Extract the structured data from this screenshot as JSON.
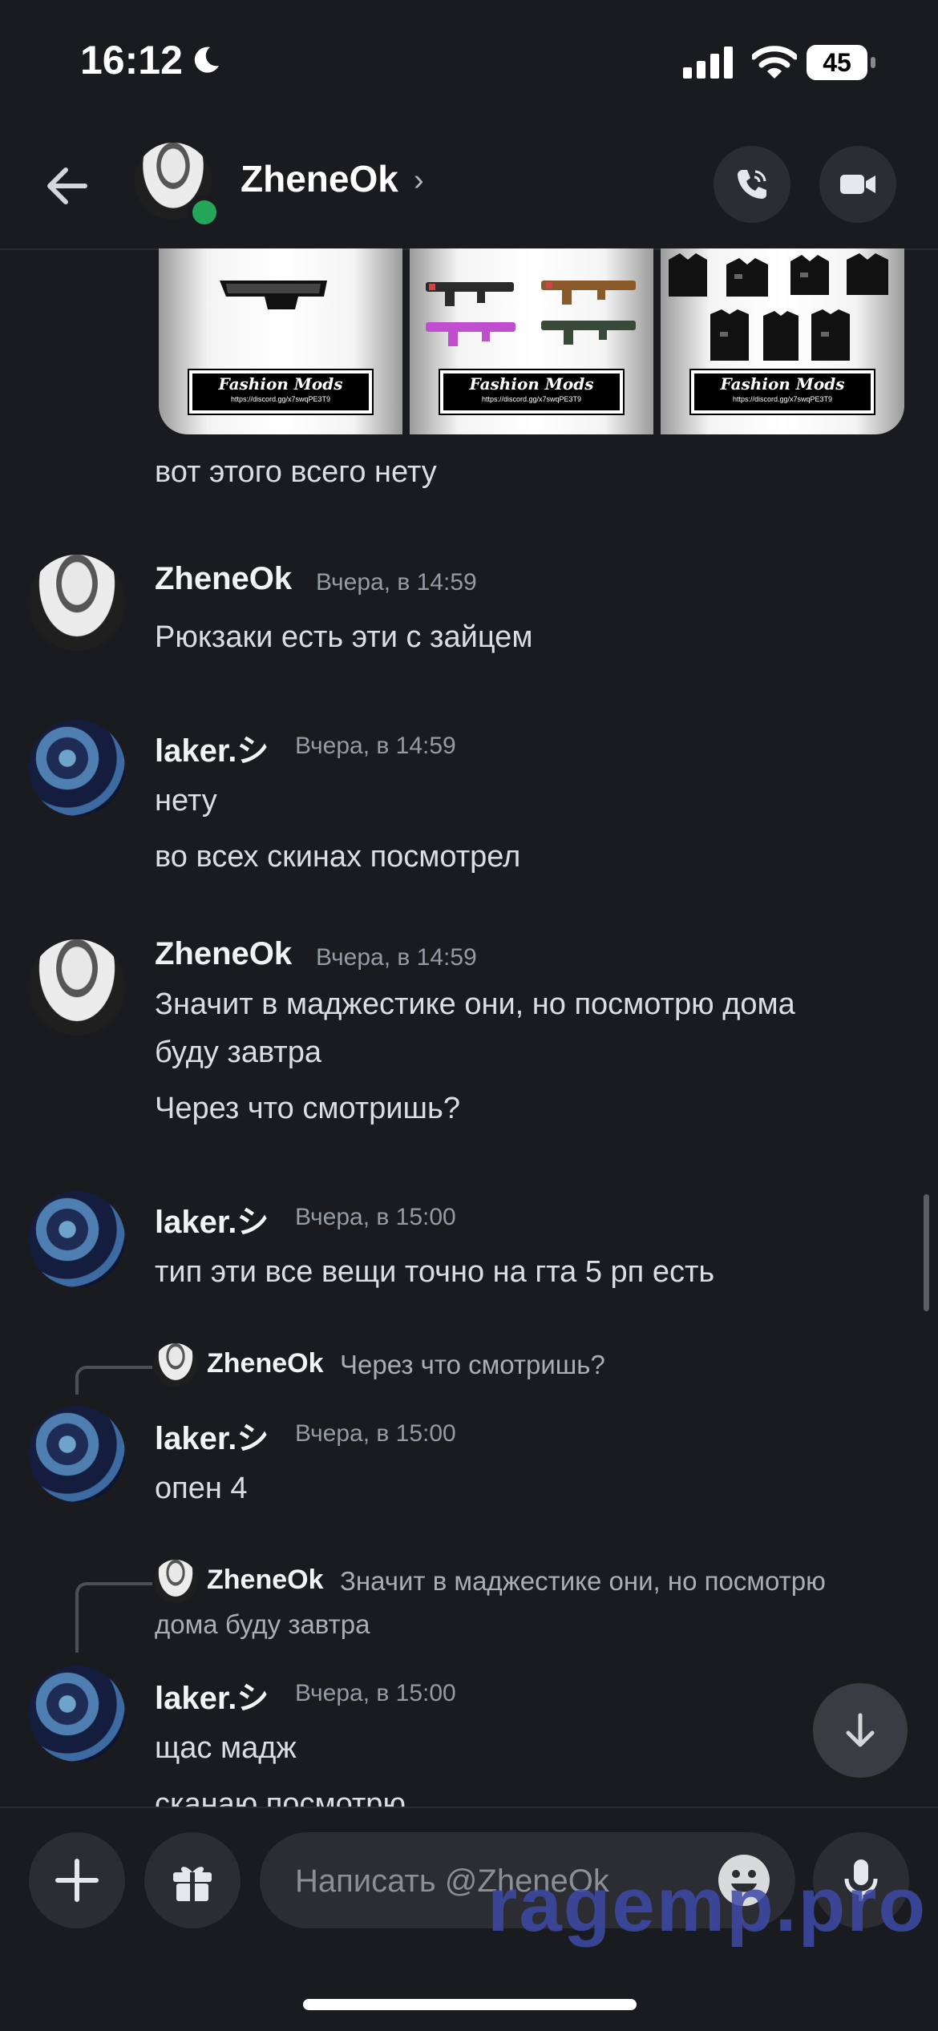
{
  "status_bar": {
    "time": "16:12",
    "battery": "45"
  },
  "header": {
    "contact_name": "ZheneOk",
    "chevron": "›"
  },
  "messages": [
    {
      "text": "вот этого всего нету"
    },
    {
      "author": "ZheneOk",
      "timestamp": "Вчера, в 14:59",
      "lines": [
        "Рюкзаки есть эти с зайцем"
      ]
    },
    {
      "author": "laker.シ",
      "timestamp": "Вчера, в 14:59",
      "lines": [
        "нету",
        "во всех скинах посмотрел"
      ]
    },
    {
      "author": "ZheneOk",
      "timestamp": "Вчера, в 14:59",
      "lines": [
        "Значит в маджестике они, но посмотрю дома",
        "буду завтра",
        "Через что смотришь?"
      ]
    },
    {
      "author": "laker.シ",
      "timestamp": "Вчера, в 15:00",
      "lines": [
        "тип эти все вещи точно на гта 5 рп есть"
      ]
    },
    {
      "reply_to": {
        "author": "ZheneOk",
        "text": "Через что смотришь?"
      },
      "author": "laker.シ",
      "timestamp": "Вчера, в 15:00",
      "lines": [
        "опен 4"
      ]
    },
    {
      "reply_to": {
        "author": "ZheneOk",
        "text": "Значит в маджестике они, но посмотрю",
        "text2": "дома буду завтра"
      },
      "author": "laker.シ",
      "timestamp": "Вчера, в 15:00",
      "lines": [
        "щас мадж",
        "сканаю посмотрю"
      ]
    }
  ],
  "attachments": [
    {
      "logo": "Fashion Mods",
      "link": "https://discord.gg/x7swqPE3T9"
    },
    {
      "logo": "Fashion Mods",
      "link": "https://discord.gg/x7swqPE3T9"
    },
    {
      "logo": "Fashion Mods",
      "link": "https://discord.gg/x7swqPE3T9"
    }
  ],
  "composer": {
    "placeholder": "Написать @ZheneOk"
  },
  "watermark": "ragemp.pro",
  "icons": {
    "back": "arrow-left-icon",
    "call": "phone-icon",
    "video": "video-camera-icon",
    "add": "plus-icon",
    "gift": "gift-icon",
    "emoji": "emoji-icon",
    "mic": "microphone-icon",
    "jump": "arrow-down-icon"
  }
}
